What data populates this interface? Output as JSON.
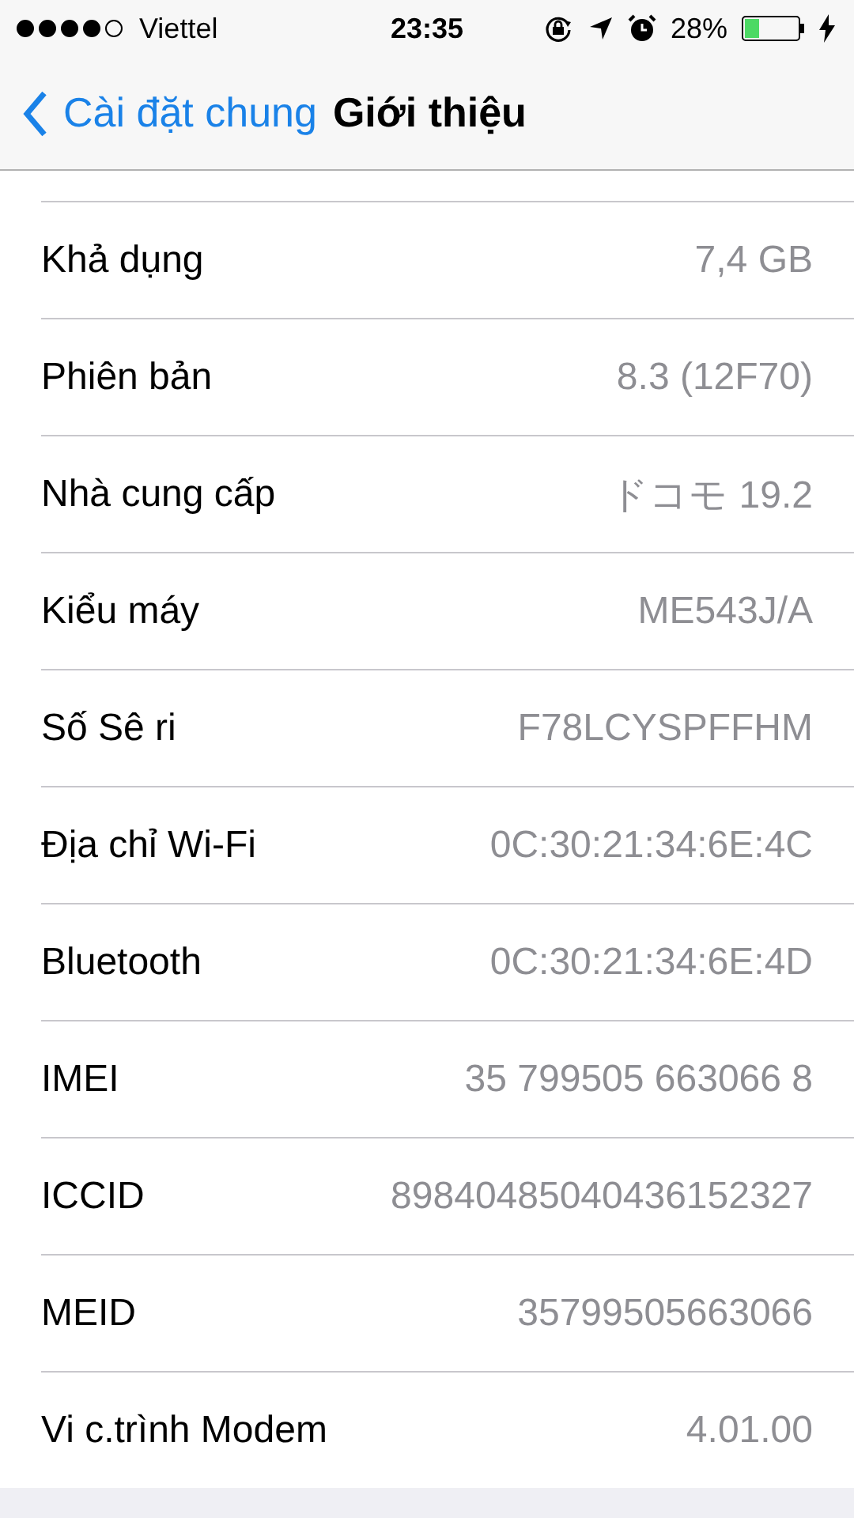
{
  "status_bar": {
    "carrier": "Viettel",
    "time": "23:35",
    "battery": "28%"
  },
  "nav": {
    "back": "Cài đặt chung",
    "title": "Giới thiệu"
  },
  "rows": [
    {
      "label": "Khả dụng",
      "value": "7,4 GB"
    },
    {
      "label": "Phiên bản",
      "value": "8.3 (12F70)"
    },
    {
      "label": "Nhà cung cấp",
      "value": "ドコモ 19.2"
    },
    {
      "label": "Kiểu máy",
      "value": "ME543J/A"
    },
    {
      "label": "Số Sê ri",
      "value": "F78LCYSPFFHM"
    },
    {
      "label": "Địa chỉ Wi-Fi",
      "value": "0C:30:21:34:6E:4C"
    },
    {
      "label": "Bluetooth",
      "value": "0C:30:21:34:6E:4D"
    },
    {
      "label": "IMEI",
      "value": "35 799505 663066 8"
    },
    {
      "label": "ICCID",
      "value": "89840485040436152327"
    },
    {
      "label": "MEID",
      "value": "35799505663066"
    },
    {
      "label": "Vi c.trình Modem",
      "value": "4.01.00"
    }
  ]
}
